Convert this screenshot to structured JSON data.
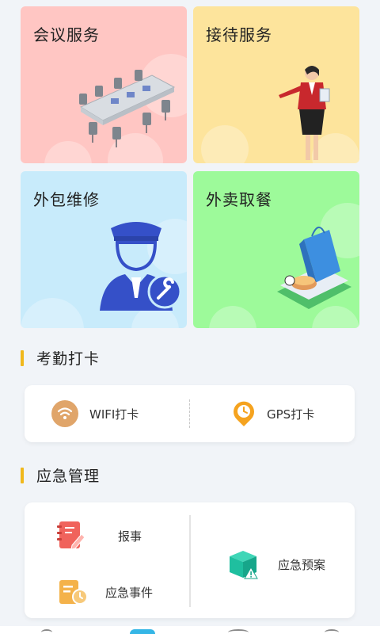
{
  "services": {
    "meeting": {
      "label": "会议服务",
      "bg": "#ffc6c3"
    },
    "reception": {
      "label": "接待服务",
      "bg": "#fde49c"
    },
    "repair": {
      "label": "外包维修",
      "bg": "#c8ebfb"
    },
    "takeout": {
      "label": "外卖取餐",
      "bg": "#9dfa9a"
    }
  },
  "attendance": {
    "title": "考勤打卡",
    "wifi_label": "WIFI打卡",
    "gps_label": "GPS打卡"
  },
  "emergency": {
    "title": "应急管理",
    "report_label": "报事",
    "event_label": "应急事件",
    "plan_label": "应急预案"
  },
  "colors": {
    "accent": "#f0b81c",
    "wifi_icon": "#e0a56a",
    "gps_icon": "#f5a31f",
    "report_icon": "#f0635c",
    "event_icon": "#f4b24a",
    "plan_icon": "#1fbf9f"
  },
  "icons": {
    "wifi": "wifi-icon",
    "gps": "clock-pin-icon",
    "report": "notebook-pen-icon",
    "event": "document-clock-icon",
    "plan": "box-warning-icon"
  }
}
